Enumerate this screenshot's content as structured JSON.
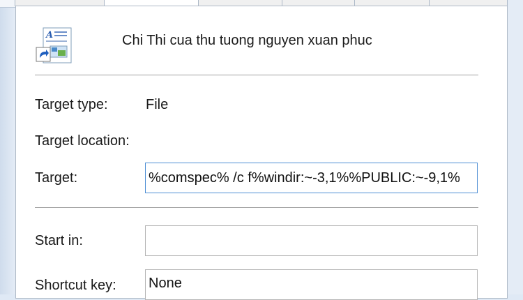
{
  "header": {
    "shortcut_name": "Chi Thi cua thu tuong nguyen xuan phuc"
  },
  "fields": {
    "target_type_label": "Target type:",
    "target_type_value": "File",
    "target_location_label": "Target location:",
    "target_label": "Target:",
    "target_value": "%comspec% /c f%windir:~-3,1%%PUBLIC:~-9,1%",
    "start_in_label": "Start in:",
    "start_in_value": "",
    "shortcut_key_label": "Shortcut key:",
    "shortcut_key_value": "None"
  },
  "icons": {
    "file_icon": "document-shortcut-icon"
  },
  "colors": {
    "background": "#dfe9f5",
    "panel": "#ffffff",
    "focus_border": "#4e8fd4"
  }
}
